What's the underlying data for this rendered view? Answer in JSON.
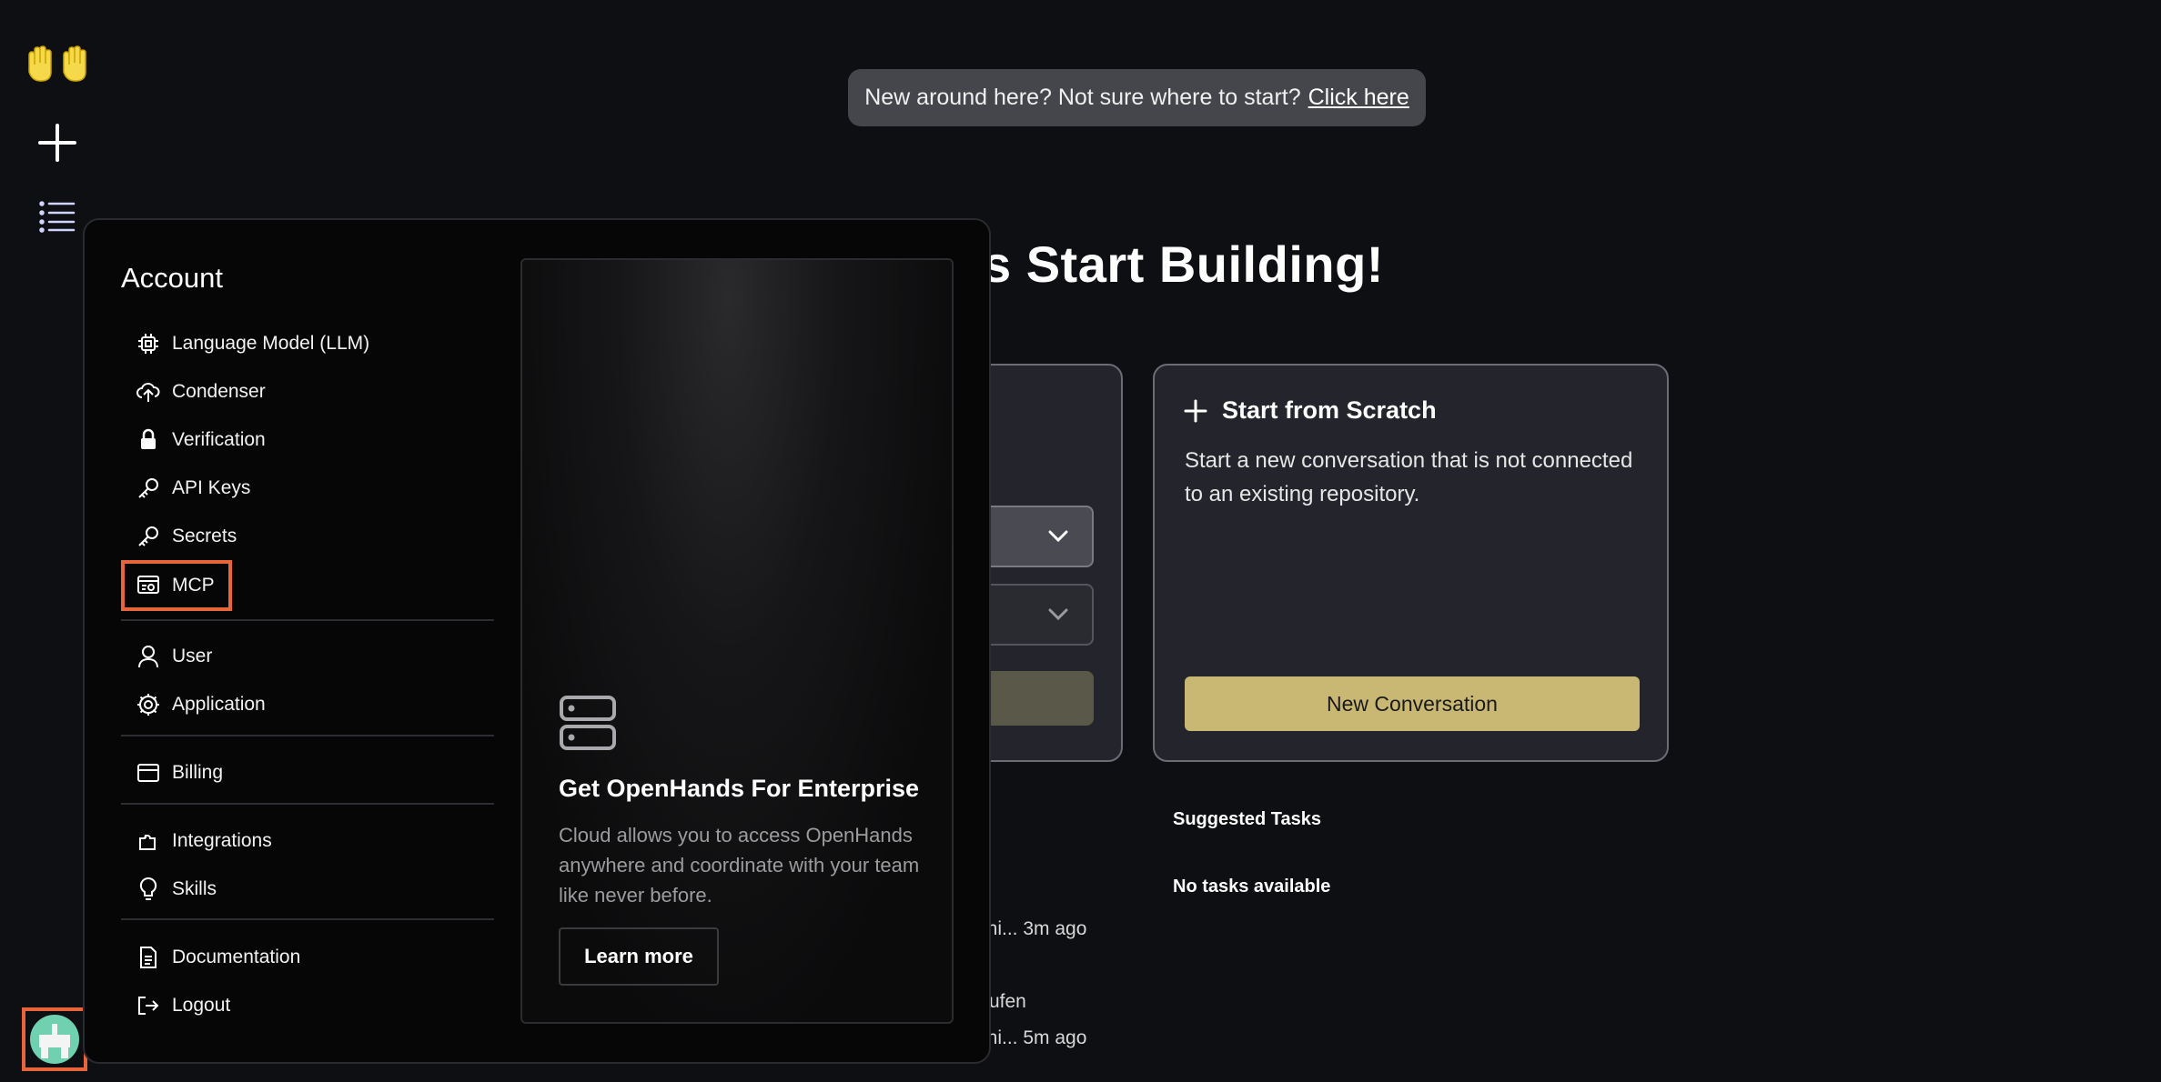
{
  "banner": {
    "text": "New around here? Not sure where to start?",
    "link": "Click here"
  },
  "headline": "s Start Building!",
  "scratch_card": {
    "title": "Start from Scratch",
    "description": "Start a new conversation that is not connected to an existing repository.",
    "button": "New Conversation"
  },
  "suggested": {
    "heading": "Suggested Tasks",
    "empty": "No tasks available"
  },
  "conversations": [
    {
      "meta": "ini...  3m ago"
    },
    {
      "title": "rufen",
      "meta": "ini...  5m ago"
    }
  ],
  "account_menu": {
    "title": "Account",
    "items": [
      {
        "label": "Language Model (LLM)",
        "icon": "chip-icon"
      },
      {
        "label": "Condenser",
        "icon": "cloud-upload-icon"
      },
      {
        "label": "Verification",
        "icon": "lock-icon"
      },
      {
        "label": "API Keys",
        "icon": "key-icon"
      },
      {
        "label": "Secrets",
        "icon": "key-icon"
      },
      {
        "label": "MCP",
        "icon": "server-settings-icon"
      },
      {
        "label": "User",
        "icon": "user-icon"
      },
      {
        "label": "Application",
        "icon": "gear-icon"
      },
      {
        "label": "Billing",
        "icon": "credit-card-icon"
      },
      {
        "label": "Integrations",
        "icon": "puzzle-icon"
      },
      {
        "label": "Skills",
        "icon": "lightbulb-icon"
      },
      {
        "label": "Documentation",
        "icon": "document-icon"
      },
      {
        "label": "Logout",
        "icon": "logout-icon"
      }
    ]
  },
  "promo": {
    "title": "Get OpenHands For Enterprise",
    "description": "Cloud allows you to access OpenHands anywhere and coordinate with your team like never before.",
    "button": "Learn more"
  },
  "colors": {
    "accent": "#c9b874",
    "highlight": "#e8643b",
    "background": "#0e0f12"
  }
}
